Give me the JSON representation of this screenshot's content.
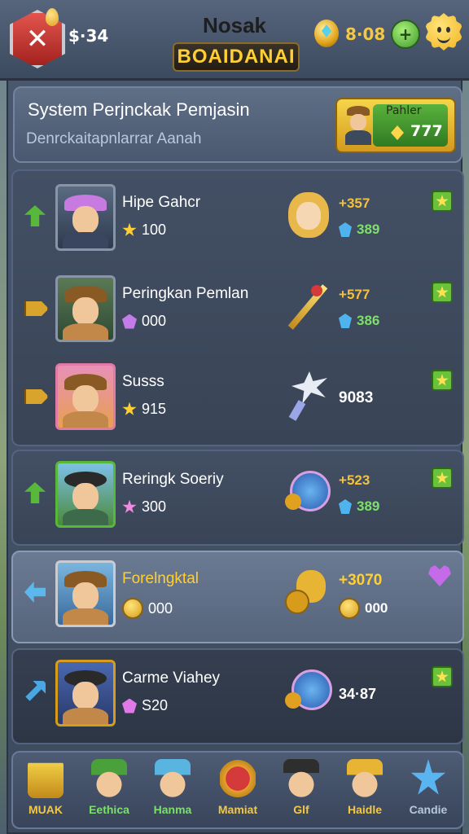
{
  "header": {
    "money": "$·34",
    "title_top": "Nosak",
    "title_plaque": "BOAIDANAI",
    "gem_count": "8·08"
  },
  "panel": {
    "title": "System Perjnckak Pemjasin",
    "subtitle": "Denrckaitapnlarrar Aanah",
    "player_label": "Pahler",
    "player_score": "777"
  },
  "rows": [
    {
      "name": "Hipe Gahcr",
      "stat": "100",
      "reward_top": "357",
      "reward_bottom": "389"
    },
    {
      "name": "Peringkan Pemlan",
      "stat": "000",
      "reward_top": "577",
      "reward_bottom": "386"
    },
    {
      "name": "Susss",
      "stat": "915",
      "reward_mid": "9083"
    },
    {
      "name": "Reringk Soeriy",
      "stat": "300",
      "reward_top": "523",
      "reward_bottom": "389"
    },
    {
      "name": "Forelngktal",
      "stat": "000",
      "reward_top": "3070",
      "reward_bottom": "000"
    },
    {
      "name": "Carme Viahey",
      "stat": "S20",
      "reward_mid": "34·87"
    }
  ],
  "nav": [
    {
      "label": "MUAK",
      "color": "#f2c845"
    },
    {
      "label": "Eethica",
      "color": "#7de06a"
    },
    {
      "label": "Hanma",
      "color": "#7de06a"
    },
    {
      "label": "Mamiat",
      "color": "#f2c845"
    },
    {
      "label": "Glf",
      "color": "#f2c845"
    },
    {
      "label": "Haidle",
      "color": "#f2c845"
    },
    {
      "label": "Candie",
      "color": "#b9c8dc"
    }
  ]
}
